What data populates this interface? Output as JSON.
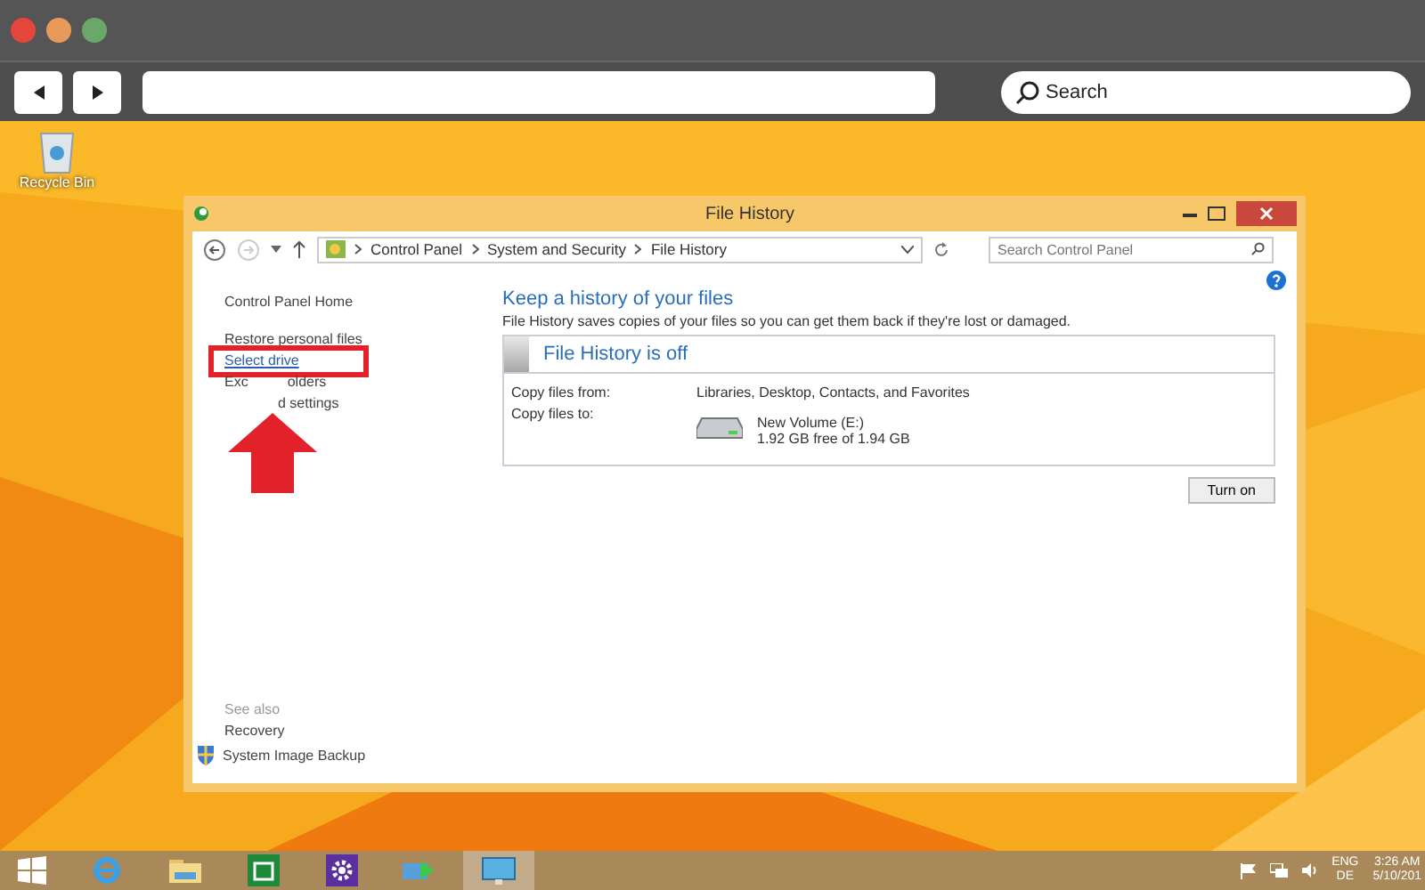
{
  "browser": {
    "search": {
      "placeholder": "Search"
    }
  },
  "desktop": {
    "icons": [
      {
        "label": "Recycle Bin"
      }
    ]
  },
  "window": {
    "title": "File History",
    "breadcrumb": [
      "Control Panel",
      "System and Security",
      "File History"
    ],
    "search": {
      "placeholder": "Search Control Panel"
    },
    "sidebar": {
      "items": [
        {
          "parts": [
            "Control Panel Home"
          ],
          "highlighted": false
        },
        {
          "parts": [
            "Restore personal files"
          ],
          "highlighted": false
        },
        {
          "parts": [
            "Select drive"
          ],
          "highlighted": true
        },
        {
          "parts": [
            "Exc",
            "olders"
          ],
          "highlighted": false
        },
        {
          "parts": [
            "d settings"
          ],
          "highlighted": false
        }
      ],
      "see_also": {
        "title": "See also",
        "items": [
          {
            "text": "Recovery",
            "kind": "plain"
          },
          {
            "text": "System Image Backup",
            "kind": "shield"
          }
        ]
      }
    },
    "main": {
      "heading": "Keep a history of your files",
      "description": "File History saves copies of your files so you can get them back if they're lost or damaged.",
      "status": "File History is off",
      "rows": [
        {
          "label": "Copy files from:",
          "value": "Libraries, Desktop, Contacts, and Favorites"
        },
        {
          "label": "Copy files to:",
          "drive": {
            "name": "New Volume (E:)",
            "space": "1.92 GB free of 1.94 GB"
          }
        }
      ],
      "button": "Turn on"
    }
  },
  "taskbar": {
    "apps": [
      {
        "kind": "ie",
        "selected": false
      },
      {
        "kind": "explorer",
        "selected": false
      },
      {
        "kind": "store",
        "selected": false
      },
      {
        "kind": "settings",
        "selected": false
      },
      {
        "kind": "sync",
        "selected": false
      },
      {
        "kind": "control-panel",
        "selected": true
      }
    ],
    "tray": {
      "language": [
        "ENG",
        "DE"
      ],
      "time": "3:26 AM",
      "date": "5/10/201"
    }
  }
}
